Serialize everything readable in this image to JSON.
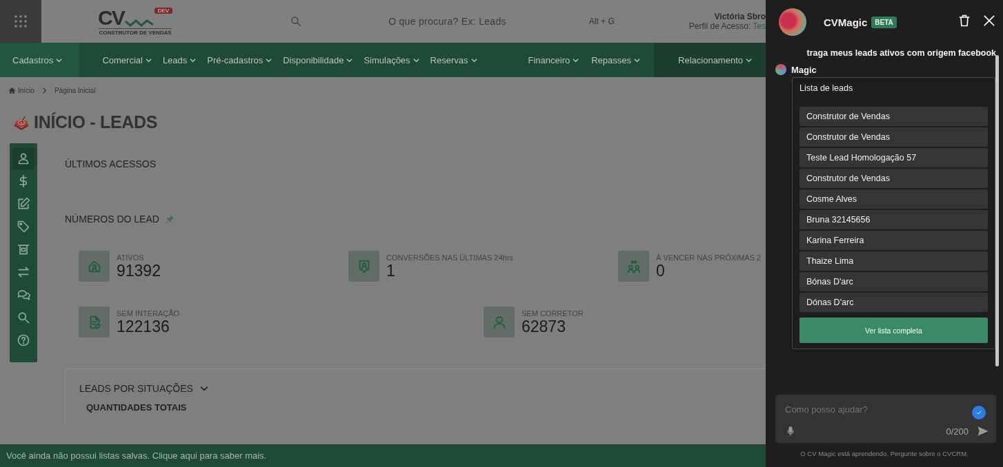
{
  "header": {
    "logo": {
      "mark": "CV",
      "badge": "DEV",
      "tagline": "CONSTRUTOR DE VENDAS"
    },
    "search": {
      "placeholder": "O que procura? Ex: Leads",
      "shortcut": "Alt + G"
    },
    "user": {
      "name": "Victória Sbro",
      "profile": "Perfil de Acesso:",
      "profile_value": "Tes"
    }
  },
  "nav": [
    {
      "items": [
        "Cadastros"
      ]
    },
    {
      "items": [
        "Comercial",
        "Leads",
        "Pré-cadastros",
        "Disponibilidade",
        "Simulações",
        "Reservas"
      ]
    },
    {
      "items": [
        "Financeiro",
        "Repasses"
      ]
    },
    {
      "items": [
        "Relacionamento"
      ]
    }
  ],
  "breadcrumb": [
    "Início",
    "Página Inicial"
  ],
  "title": "INÍCIO - LEADS",
  "tools": [
    {
      "selected": true
    },
    {
      "selected": false
    },
    {
      "selected": false
    },
    {
      "selected": false
    },
    {
      "selected": false
    },
    {
      "selected": false
    },
    {
      "selected": false
    },
    {
      "selected": false
    },
    {
      "selected": false
    }
  ],
  "sections": [
    "ÚLTIMOS ACESSOS",
    "NÚMEROS DO LEAD"
  ],
  "stats": [
    [
      {
        "label": "ATIVOS",
        "value": "91392"
      },
      {
        "label": "CONVERSÕES NAS ÚLTIMAS 24hrs",
        "value": "1"
      },
      {
        "label": "À VENCER NAS PRÓXIMAS 2",
        "value": "0"
      }
    ],
    [
      {
        "label": "SEM INTERAÇÃO",
        "value": "122136"
      },
      {
        "label": "SEM CORRETOR",
        "value": "62873"
      }
    ]
  ],
  "situations": {
    "title": "LEADS POR SITUAÇÕES",
    "subtitle": "QUANTIDADES TOTAIS"
  },
  "bottom_bar": "Você ainda não possui listas salvas. Clique aqui para saber mais.",
  "chat": {
    "title": "CVMagic",
    "badge": "BETA",
    "user_message": "traga meus leads ativos com origem facebook",
    "bot_name": "Magic",
    "card": {
      "title": "Lista de leads",
      "leads": [
        "Construtor de Vendas",
        "Construtor de Vendas",
        "Teste Lead Homologação 57",
        "Construtor de Vendas",
        "Cosme Alves",
        "Bruna 32145656",
        "Karina Ferreira",
        "Thaize Lima",
        "Bónas D'arc",
        "Dónas D'arc"
      ],
      "button": "Ver lista completa"
    },
    "input": {
      "placeholder": "Como posso ajudar?",
      "counter": "0/200"
    },
    "footer": "O CV Magic está aprendendo. Pergunte sobre o CVCRM."
  }
}
